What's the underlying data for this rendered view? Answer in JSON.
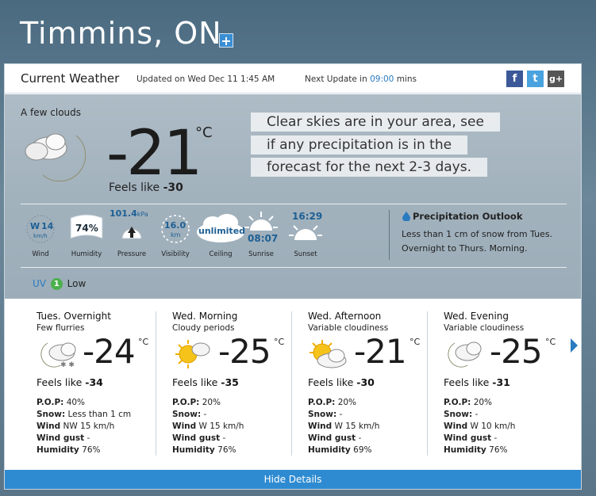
{
  "location": {
    "title": "Timmins, ON",
    "add_label": "+"
  },
  "header": {
    "title": "Current Weather",
    "updated": "Updated on Wed Dec 11 1:45 AM",
    "next_prefix": "Next Update in",
    "next_time": "09:00",
    "next_suffix": "mins",
    "social": [
      "f",
      "t",
      "g+"
    ]
  },
  "current": {
    "condition": "A few clouds",
    "temp": "-21",
    "unit": "°C",
    "feels_label": "Feels like",
    "feels_value": "-30",
    "message_lines": [
      "Clear skies are in your area, see",
      "if any precipitation is in the",
      "forecast for the next 2-3 days."
    ],
    "icon": "moon-cloud-icon"
  },
  "stats": {
    "wind": {
      "dir": "W",
      "speed": "14",
      "unit": "km/h",
      "label": "Wind"
    },
    "humidity": {
      "value": "74%",
      "label": "Humidity"
    },
    "pressure": {
      "value": "101.4",
      "unit": "kPa",
      "label": "Pressure"
    },
    "visibility": {
      "value": "16.0",
      "unit": "km",
      "label": "Visibility"
    },
    "ceiling": {
      "value": "unlimited",
      "label": "Ceiling"
    },
    "sunrise": {
      "value": "08:07",
      "label": "Sunrise"
    },
    "sunset": {
      "value": "16:29",
      "label": "Sunset"
    }
  },
  "precip": {
    "title": "Precipitation Outlook",
    "text": "Less than 1 cm of snow from Tues. Overnight to Thurs. Morning."
  },
  "uv": {
    "label": "UV",
    "value": "1",
    "level": "Low"
  },
  "forecast": [
    {
      "period": "Tues. Overnight",
      "desc": "Few flurries",
      "temp": "-24",
      "unit": "°C",
      "feels_label": "Feels like",
      "feels": "-34",
      "pop_label": "P.O.P:",
      "pop": "40%",
      "snow_label": "Snow:",
      "snow": "Less than 1 cm",
      "wind_label": "Wind",
      "wind": "NW 15 km/h",
      "gust_label": "Wind gust",
      "gust": "-",
      "hum_label": "Humidity",
      "hum": "76%",
      "icon": "moon-snow-cloud-icon"
    },
    {
      "period": "Wed. Morning",
      "desc": "Cloudy periods",
      "temp": "-25",
      "unit": "°C",
      "feels_label": "Feels like",
      "feels": "-35",
      "pop_label": "P.O.P:",
      "pop": "20%",
      "snow_label": "Snow:",
      "snow": "-",
      "wind_label": "Wind",
      "wind": "W 15 km/h",
      "gust_label": "Wind gust",
      "gust": "-",
      "hum_label": "Humidity",
      "hum": "76%",
      "icon": "sun-cloud-icon"
    },
    {
      "period": "Wed. Afternoon",
      "desc": "Variable cloudiness",
      "temp": "-21",
      "unit": "°C",
      "feels_label": "Feels like",
      "feels": "-30",
      "pop_label": "P.O.P:",
      "pop": "20%",
      "snow_label": "Snow:",
      "snow": "-",
      "wind_label": "Wind",
      "wind": "W 15 km/h",
      "gust_label": "Wind gust",
      "gust": "-",
      "hum_label": "Humidity",
      "hum": "69%",
      "icon": "sun-cloud-icon"
    },
    {
      "period": "Wed. Evening",
      "desc": "Variable cloudiness",
      "temp": "-25",
      "unit": "°C",
      "feels_label": "Feels like",
      "feels": "-31",
      "pop_label": "P.O.P:",
      "pop": "20%",
      "snow_label": "Snow:",
      "snow": "-",
      "wind_label": "Wind",
      "wind": "W 10 km/h",
      "gust_label": "Wind gust",
      "gust": "-",
      "hum_label": "Humidity",
      "hum": "76%",
      "icon": "moon-cloud-icon"
    }
  ],
  "footer": {
    "hide_label": "Hide Details"
  }
}
